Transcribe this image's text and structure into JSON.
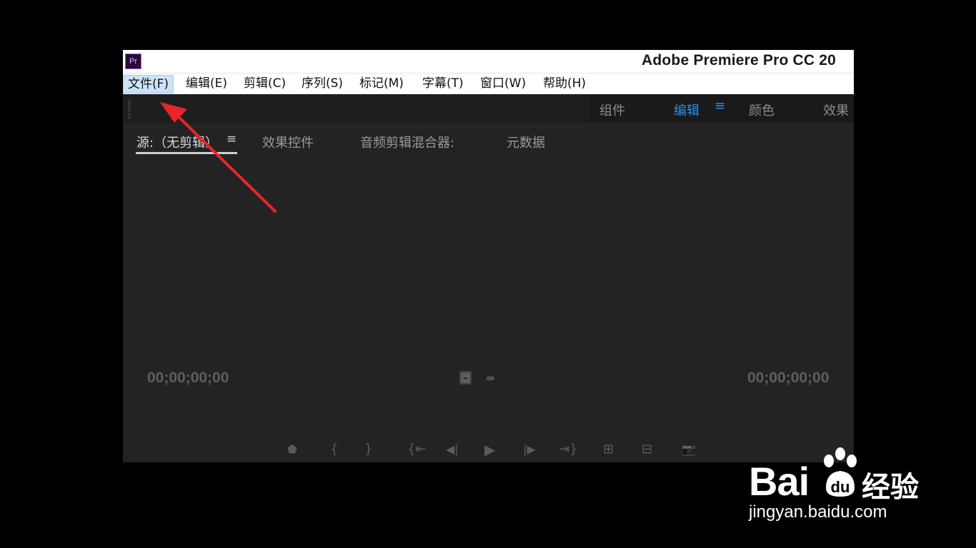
{
  "window": {
    "app_icon_text": "Pr",
    "title": "Adobe Premiere Pro CC 20"
  },
  "menubar": {
    "items": [
      {
        "label": "文件(F)"
      },
      {
        "label": "编辑(E)"
      },
      {
        "label": "剪辑(C)"
      },
      {
        "label": "序列(S)"
      },
      {
        "label": "标记(M)"
      },
      {
        "label": "字幕(T)"
      },
      {
        "label": "窗口(W)"
      },
      {
        "label": "帮助(H)"
      }
    ],
    "active_index": 0
  },
  "workspaces": {
    "tabs": [
      {
        "label": "组件"
      },
      {
        "label": "编辑"
      },
      {
        "label": "颜色"
      },
      {
        "label": "效果"
      }
    ],
    "active": "编辑",
    "menu_icon": "≡"
  },
  "source_panel": {
    "tabs": [
      {
        "label": "源:（无剪辑）"
      },
      {
        "label": "效果控件"
      },
      {
        "label": "音频剪辑混合器:"
      },
      {
        "label": "元数据"
      }
    ],
    "menu_icon": "≡",
    "timecode_left": "00;00;00;00",
    "timecode_right": "00;00;00;00",
    "drop_icons": [
      "drag-video-only-icon",
      "drag-audio-only-icon"
    ],
    "controls": [
      {
        "name": "add-marker-icon",
        "glyph": "⬟"
      },
      {
        "name": "mark-in-icon",
        "glyph": "{"
      },
      {
        "name": "mark-out-icon",
        "glyph": "}"
      },
      {
        "name": "go-to-in-icon",
        "glyph": "{⇤"
      },
      {
        "name": "step-back-icon",
        "glyph": "◀|"
      },
      {
        "name": "play-icon",
        "glyph": "▶"
      },
      {
        "name": "step-forward-icon",
        "glyph": "|▶"
      },
      {
        "name": "go-to-out-icon",
        "glyph": "⇥}"
      },
      {
        "name": "insert-icon",
        "glyph": "⊞"
      },
      {
        "name": "overwrite-icon",
        "glyph": "⊟"
      },
      {
        "name": "export-frame-icon",
        "glyph": "📷"
      }
    ]
  },
  "annotation": {
    "arrow_color": "#e8252a"
  },
  "watermark": {
    "brand": "Bai",
    "brand_du": "du",
    "product": "经验",
    "url": "jingyan.baidu.com"
  },
  "colors": {
    "accent": "#2d8ceb",
    "panel_bg": "#232323",
    "menu_active_bg": "#cce4f7"
  }
}
